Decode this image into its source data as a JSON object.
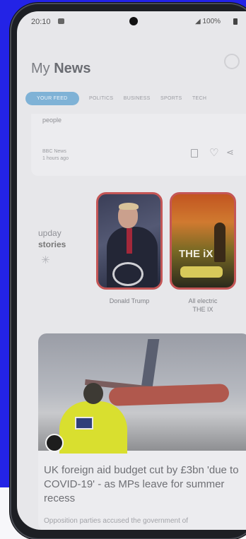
{
  "status_bar": {
    "time": "20:10",
    "battery": "100%"
  },
  "header": {
    "title_prefix": "My",
    "title_bold": "News"
  },
  "tabs": [
    {
      "label": "YOUR FEED",
      "active": true
    },
    {
      "label": "POLITICS",
      "active": false
    },
    {
      "label": "BUSINESS",
      "active": false
    },
    {
      "label": "SPORTS",
      "active": false
    },
    {
      "label": "TECH",
      "active": false
    }
  ],
  "top_card": {
    "lead_text": "people",
    "source": "BBC News",
    "time": "1 hours ago"
  },
  "stories_section": {
    "line1": "upday",
    "line2": "stories"
  },
  "stories": [
    {
      "label": "Donald Trump"
    },
    {
      "label_line1": "All electric",
      "label_line2": "THE IX",
      "overlay_text": "THE iX"
    }
  ],
  "article": {
    "headline": "UK foreign aid budget cut by £3bn 'due to COVID-19' - as MPs leave for summer recess",
    "snippet": "Opposition parties accused the government of"
  },
  "colors": {
    "background_blue": "#2323e6",
    "active_tab": "#7fb2d6",
    "story_border": "#c45656"
  }
}
